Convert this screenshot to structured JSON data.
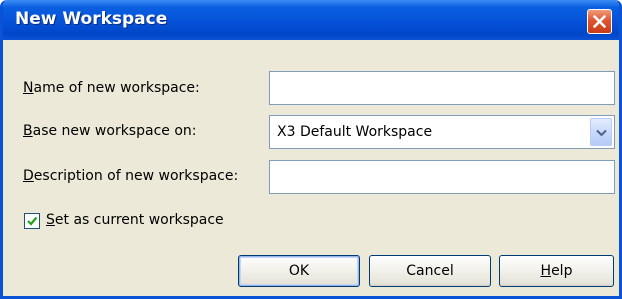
{
  "dialog": {
    "title": "New Workspace"
  },
  "fields": {
    "name_label_accel": "N",
    "name_label_rest": "ame of new workspace:",
    "name_value": "",
    "base_label_accel": "B",
    "base_label_rest": "ase new workspace on:",
    "base_selected": "X3 Default Workspace",
    "description_label_accel": "D",
    "description_label_rest": "escription of new workspace:",
    "description_value": ""
  },
  "options": {
    "set_current_accel": "S",
    "set_current_rest": "et as current workspace",
    "set_current_checked": true
  },
  "buttons": {
    "ok": "OK",
    "cancel": "Cancel",
    "help_accel": "H",
    "help_rest": "elp"
  },
  "icons": {
    "close": "close-icon",
    "dropdown": "chevron-down-icon",
    "checkmark": "checkmark-icon"
  },
  "colors": {
    "titlebar": "#0552d8",
    "dialog_bg": "#ece9d8",
    "close_button": "#e0552f",
    "field_border": "#7f9db9"
  }
}
